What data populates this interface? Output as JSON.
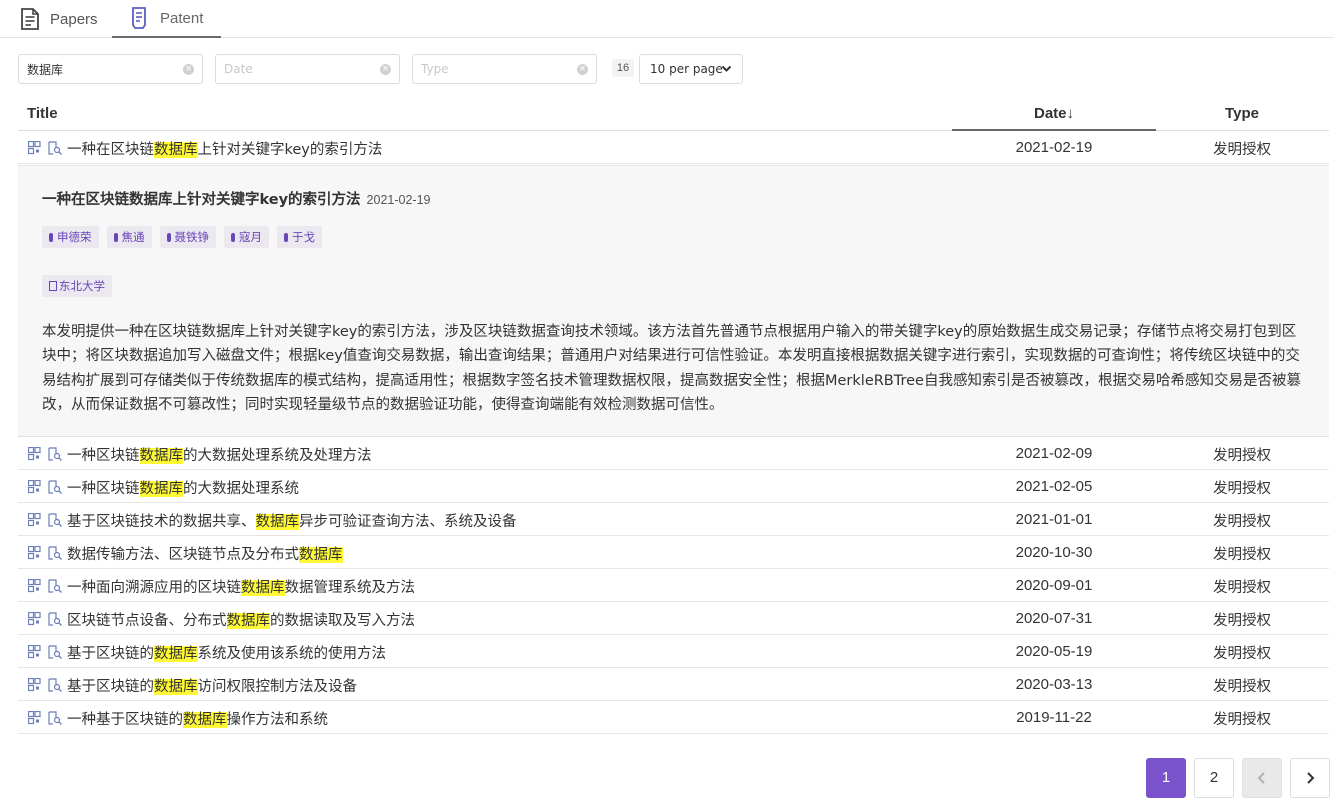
{
  "tabs": [
    {
      "label": "Papers"
    },
    {
      "label": "Patent"
    }
  ],
  "filters": {
    "query_value": "数据库",
    "date_placeholder": "Date",
    "type_placeholder": "Type",
    "count": "16",
    "per_page": "10 per page"
  },
  "table": {
    "headers": {
      "title": "Title",
      "date": "Date↓",
      "type": "Type"
    },
    "highlight": "数据库",
    "rows": [
      {
        "pre": "一种在区块链",
        "hl": "数据库",
        "post": "上针对关键字key的索引方法",
        "date": "2021-02-19",
        "type": "发明授权"
      },
      {
        "pre": "一种区块链",
        "hl": "数据库",
        "post": "的大数据处理系统及处理方法",
        "date": "2021-02-09",
        "type": "发明授权"
      },
      {
        "pre": "一种区块链",
        "hl": "数据库",
        "post": "的大数据处理系统",
        "date": "2021-02-05",
        "type": "发明授权"
      },
      {
        "pre": "基于区块链技术的数据共享、",
        "hl": "数据库",
        "post": "异步可验证查询方法、系统及设备",
        "date": "2021-01-01",
        "type": "发明授权"
      },
      {
        "pre": "数据传输方法、区块链节点及分布式",
        "hl": "数据库",
        "post": "",
        "date": "2020-10-30",
        "type": "发明授权"
      },
      {
        "pre": "一种面向溯源应用的区块链",
        "hl": "数据库",
        "post": "数据管理系统及方法",
        "date": "2020-09-01",
        "type": "发明授权"
      },
      {
        "pre": "区块链节点设备、分布式",
        "hl": "数据库",
        "post": "的数据读取及写入方法",
        "date": "2020-07-31",
        "type": "发明授权"
      },
      {
        "pre": "基于区块链的",
        "hl": "数据库",
        "post": "系统及使用该系统的使用方法",
        "date": "2020-05-19",
        "type": "发明授权"
      },
      {
        "pre": "基于区块链的",
        "hl": "数据库",
        "post": "访问权限控制方法及设备",
        "date": "2020-03-13",
        "type": "发明授权"
      },
      {
        "pre": "一种基于区块链的",
        "hl": "数据库",
        "post": "操作方法和系统",
        "date": "2019-11-22",
        "type": "发明授权"
      }
    ]
  },
  "detail": {
    "title": "一种在区块链数据库上针对关键字key的索引方法",
    "date": "2021-02-19",
    "inventors": [
      "申德荣",
      "焦通",
      "聂铁铮",
      "寇月",
      "于戈"
    ],
    "organization": "东北大学",
    "abstract": "本发明提供一种在区块链数据库上针对关键字key的索引方法，涉及区块链数据查询技术领域。该方法首先普通节点根据用户输入的带关键字key的原始数据生成交易记录；存储节点将交易打包到区块中；将区块数据追加写入磁盘文件；根据key值查询交易数据，输出查询结果；普通用户对结果进行可信性验证。本发明直接根据数据关键字进行索引，实现数据的可查询性；将传统区块链中的交易结构扩展到可存储类似于传统数据库的模式结构，提高适用性；根据数字签名技术管理数据权限，提高数据安全性；根据MerkleRBTree自我感知索引是否被篡改，根据交易哈希感知交易是否被篡改，从而保证数据不可篡改性；同时实现轻量级节点的数据验证功能，使得查询端能有效检测数据可信性。"
  },
  "pagination": {
    "pages": [
      "1",
      "2"
    ],
    "current": "1",
    "prev": "‹",
    "next": "›"
  },
  "colors": {
    "accent": "#7a52cc",
    "highlight": "#fff936",
    "chip_bg": "#ebe8f0",
    "chip_text": "#6a46b8"
  }
}
